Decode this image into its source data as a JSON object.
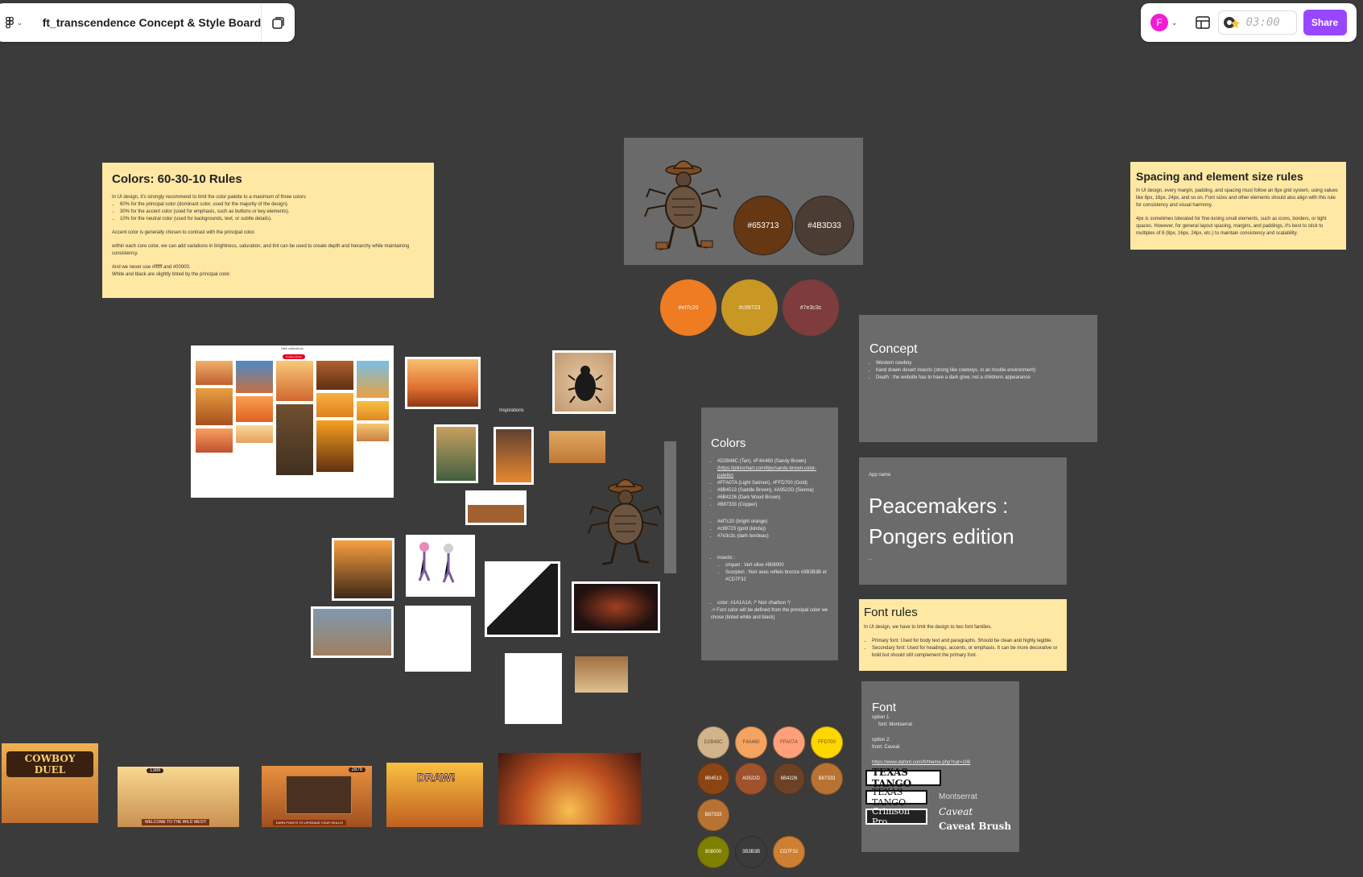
{
  "toolbar": {
    "file_title": "ft_transcendence Concept & Style Board",
    "timer": "03:00",
    "share_label": "Share",
    "avatar_initial": "F"
  },
  "colors_rules": {
    "title": "Colors: 60-30-10 Rules",
    "intro": "In UI design, it's strongly recommend to limit the color palette to a maximum of three colors",
    "items": [
      "60% for the principal color (dominant color, used for the majority of the design).",
      "30% for the accent color (used for emphasis, such as buttons or key elements).",
      "10% for the neutral color (used for backgrounds, text, or subtle details)."
    ],
    "p1": "Accent color is generally chosen to contrast with the principal color.",
    "p2": "within each core color, we can add variations in brightness, saturation, and tint can be used to create depth and hierarchy while maintaining consistency.",
    "p3": "And we never use #ffffff and #00000.",
    "p4": "White and black are slightly tinted by the principal color."
  },
  "spacing_rules": {
    "title": "Spacing and element size rules",
    "p1": "In UI design, every margin, padding, and spacing must follow an 8px grid system, using values like 8px, 16px, 24px, and so on. Font sizes and other elements should also align with this rule for consistency and visual harmony.",
    "p2": "4px is sometimes tolerated for fine-tuning small elements, such as icons, borders, or tight spaces. However, for general layout spacing, margins, and paddings, it's best to stick to multiples of 8 (8px, 16px, 24px, etc.) to maintain consistency and scalability."
  },
  "mascot_card": {
    "swatches": [
      {
        "label": "#653713",
        "color": "#653713"
      },
      {
        "label": "#4B3D33",
        "color": "#4b3d33"
      }
    ]
  },
  "accent_swatches": [
    {
      "label": "#ef7c20",
      "color": "#ef7c20"
    },
    {
      "label": "#c99723",
      "color": "#c99723"
    },
    {
      "label": "#7e3c3c",
      "color": "#7e3c3c"
    }
  ],
  "concept": {
    "title": "Concept",
    "items": [
      "Western cowboy",
      "hand drawn desert insects (strong like cowboys, in an hostile environment)",
      "Death : the website has to have a dark glow, not a childrens appearance"
    ]
  },
  "app_name_card": {
    "label": "App name",
    "title_line1": "Peacemakers :",
    "title_line2": "Pongers edition",
    "footnote": ".."
  },
  "colors_card": {
    "title": "Colors",
    "items": [
      "#D2B48C (Tan), #F4A460 (Sandy Brown)",
      "(https://piktochart.com/tips/sandy-brown-color-palette)",
      "#FFA07A (Light Salmon), #FFD700 (Gold)",
      "#8B4513 (Saddle Brown), #A0522D (Sienna)",
      "#6B4226 (Dark Wood Brown)",
      "#B87333 (Copper)"
    ],
    "items2": [
      "#ef7c20 (bright orange)",
      "#c99723 (gold (kinda))",
      "#7e3c3c (dark bordeau)"
    ],
    "insects_label": "insects :",
    "insects": [
      "criquet : Vert olive #808000",
      "Scorpion : Noir avec reflets bronze #3B3B3B et #CD7F32"
    ],
    "color_note": "color: #1A1A1A; /* Noir charbon */",
    "font_note": "-> Font color will be defined from the principal color we chose (tinted white and black)"
  },
  "font_rules": {
    "title": "Font rules",
    "intro": "In UI design, we have to limit the design to two font families.",
    "items": [
      "Primary font: Used for body text and paragraphs. Should be clean and highly legible.",
      "Secondary font: Used for headings, accents, or emphasis. It can be more decorative or bold but should still complement the primary font."
    ]
  },
  "font_card": {
    "title": "Font",
    "option1": "option 1",
    "option1_font": "font: Montserrat",
    "option2": "option 2:",
    "option2_font": "front: Caveat",
    "link": "https://www.dafont.com/fr/theme.php?cat=106",
    "samples": [
      "TEXAS TANGO",
      "TEXAS TANGO",
      "Crimson Pro"
    ],
    "side_samples": [
      "Montserrat",
      "Caveat",
      "Caveat Brush"
    ]
  },
  "palette_swatches": [
    {
      "label": "D2B48C",
      "color": "#d2b48c"
    },
    {
      "label": "F4A460",
      "color": "#f4a460"
    },
    {
      "label": "FFA07A",
      "color": "#ffa07a"
    },
    {
      "label": "FFD700",
      "color": "#ffd700"
    },
    {
      "label": "8B4513",
      "color": "#8b4513"
    },
    {
      "label": "A0522D",
      "color": "#a0522d"
    },
    {
      "label": "6B4226",
      "color": "#6b4226"
    },
    {
      "label": "B87333",
      "color": "#b87333"
    },
    {
      "label": "B87333",
      "color": "#b87333"
    },
    {
      "label": "808000",
      "color": "#808000"
    },
    {
      "label": "3B3B3B",
      "color": "#3b3b3b"
    },
    {
      "label": "CD7F32",
      "color": "#cd7f32"
    }
  ],
  "inspirations": {
    "label": "Inspirations",
    "pinterest_header": "Mes collections",
    "pinterest_btn": "Cowboy desert"
  },
  "game_screens": {
    "cowboy_duel": "COWBOY DUEL",
    "score1": "1389",
    "score2": "2879",
    "banner1": "WELCOME TO THE WILD WEST!",
    "banner2": "EARN POINTS TO UPGRADE YOUR SKILLS!",
    "draw": "DRAW!"
  }
}
